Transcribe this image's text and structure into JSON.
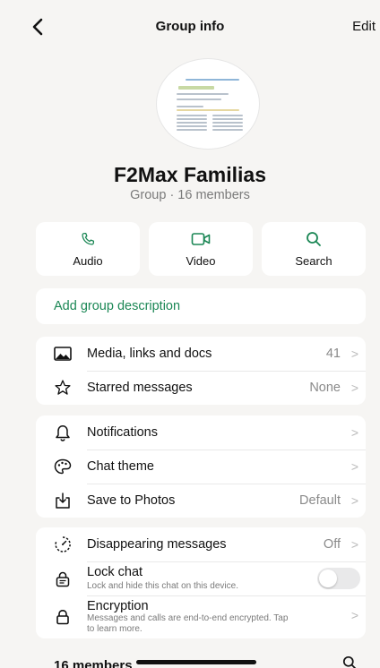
{
  "header": {
    "title": "Group info",
    "edit_label": "Edit",
    "back_icon": "chevron-left-icon"
  },
  "group": {
    "name": "F2Max Familias",
    "subtitle": "Group · 16 members"
  },
  "quick_actions": [
    {
      "label": "Audio",
      "icon": "phone-icon"
    },
    {
      "label": "Video",
      "icon": "video-camera-icon"
    },
    {
      "label": "Search",
      "icon": "search-icon"
    }
  ],
  "description": {
    "label": "Add group description"
  },
  "media_section": {
    "items": [
      {
        "label": "Media, links and docs",
        "value": "41",
        "icon": "image-icon"
      },
      {
        "label": "Starred messages",
        "value": "None",
        "icon": "star-icon"
      }
    ]
  },
  "settings_section": {
    "items": [
      {
        "label": "Notifications",
        "value": "",
        "icon": "bell-icon"
      },
      {
        "label": "Chat theme",
        "value": "",
        "icon": "palette-icon"
      },
      {
        "label": "Save to Photos",
        "value": "Default",
        "icon": "download-icon"
      }
    ]
  },
  "privacy_section": {
    "disappearing": {
      "label": "Disappearing messages",
      "value": "Off",
      "icon": "timer-icon"
    },
    "lock": {
      "label": "Lock chat",
      "sublabel": "Lock and hide this chat on this device.",
      "enabled": false,
      "icon": "lock-chat-icon"
    },
    "encryption": {
      "label": "Encryption",
      "sublabel_line1": "Messages and calls are end-to-end encrypted. Tap",
      "sublabel_line2": "to learn more.",
      "icon": "lock-icon"
    }
  },
  "members": {
    "label": "16 members"
  },
  "colors": {
    "accent_green": "#1b8755",
    "background": "#f6f5f3"
  }
}
